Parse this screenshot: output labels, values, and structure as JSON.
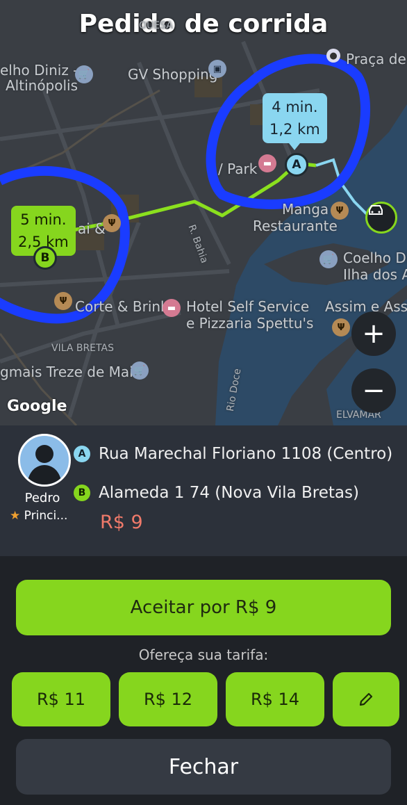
{
  "title": "Pedido de corrida",
  "map": {
    "labels": {
      "praca": "Praça de E",
      "elho_diniz": "elho Diniz -",
      "altinopolis": "Altinópolis",
      "gv_shopping": "GV Shopping",
      "park": "/ Park",
      "manga_line1": "Manga",
      "manga_line2": "Restaurante",
      "coelho_line1": "Coelho Din",
      "coelho_line2": "Ilha dos Ar",
      "corte_brink": "Corte & Brink",
      "hotel_line1": "Hotel Self Service",
      "hotel_line2": "e Pizzaria Spettu's",
      "assim": "Assim e Assa",
      "vila_bretas": "VILA BRETAS",
      "gmais": "gmais Treze de Maio",
      "elvamar": "ELVAMAR",
      "r_bahia": "R. Bahia",
      "rio_doce": "Rio Doce",
      "ai": "ai &",
      "ouesa": "OUESA"
    },
    "bubble_a": {
      "time": "4 min.",
      "distance": "1,2 km"
    },
    "bubble_b": {
      "time": "5 min.",
      "distance": "2,5 km"
    },
    "pin_a": "A",
    "pin_b": "B",
    "zoom_in": "+",
    "zoom_out": "−",
    "google": "Google"
  },
  "driver": {
    "name": "Pedro",
    "rating_star": "★",
    "rating_text": "Princi..."
  },
  "addresses": {
    "a_badge": "A",
    "a_text": "Rua Marechal Floriano 1108 (Centro)",
    "b_badge": "B",
    "b_text": "Alameda 1 74 (Nova Vila Bretas)"
  },
  "price": "R$ 9",
  "actions": {
    "accept_label": "Aceitar por R$ 9",
    "offer_label": "Ofereça sua tarifa:",
    "fares": [
      "R$ 11",
      "R$ 12",
      "R$ 14"
    ],
    "edit_icon": "pencil-icon",
    "close_label": "Fechar"
  },
  "colors": {
    "accent_green": "#86d61e",
    "bubble_blue": "#8ad6f0",
    "price_red": "#f07a6a",
    "annotation_blue": "#1a3cff"
  }
}
